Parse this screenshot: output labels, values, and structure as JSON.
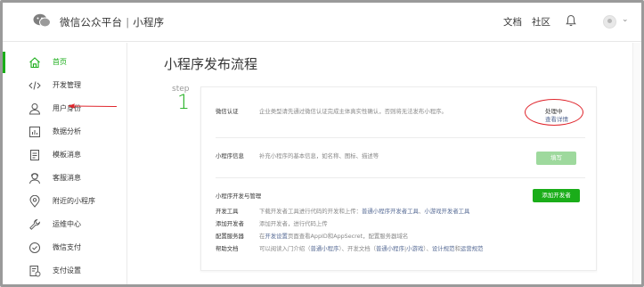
{
  "header": {
    "title": "微信公众平台",
    "separator": "|",
    "subtitle": "小程序",
    "nav": [
      "文档",
      "社区"
    ],
    "caret": "⌄"
  },
  "sidebar": {
    "items": [
      {
        "label": "首页",
        "icon": "home-icon",
        "active": true
      },
      {
        "label": "开发管理",
        "icon": "code-icon"
      },
      {
        "label": "用户身份",
        "icon": "user-icon"
      },
      {
        "label": "数据分析",
        "icon": "chart-icon"
      },
      {
        "label": "模板消息",
        "icon": "document-icon"
      },
      {
        "label": "客服消息",
        "icon": "customer-service-icon"
      },
      {
        "label": "附近的小程序",
        "icon": "location-icon"
      },
      {
        "label": "运维中心",
        "icon": "wrench-icon"
      },
      {
        "label": "微信支付",
        "icon": "payment-icon"
      },
      {
        "label": "支付设置",
        "icon": "payment-settings-icon"
      }
    ]
  },
  "main": {
    "title": "小程序发布流程",
    "step_label": "step",
    "step_number": "1",
    "rows": {
      "verify": {
        "label": "微信认证",
        "desc": "企业类型请先通过微信认证完成主体真实性确认，否则将无法发布小程序。",
        "status": "处理中",
        "status_link": "查看详情"
      },
      "info": {
        "label": "小程序信息",
        "desc": "补充小程序的基本信息，如名称、图标、描述等",
        "button": "填写"
      },
      "dev": {
        "label": "小程序开发与管理",
        "button": "添加开发者",
        "lines": [
          {
            "label": "开发工具",
            "desc_pre": "下载开发者工具进行代码的开发和上传：",
            "link1": "普通小程序开发者工具",
            "mid": "、",
            "link2": "小游戏开发者工具"
          },
          {
            "label": "添加开发者",
            "desc_pre": "添加开发者，进行代码上传"
          },
          {
            "label": "配置服务器",
            "desc_pre": "在",
            "link1": "开发设置",
            "mid": "页面查看AppID和AppSecret，配置服务器域名"
          },
          {
            "label": "帮助文档",
            "desc_pre": "可以阅读入门介绍（",
            "link1": "普通小程序",
            "mid": "）、开发文档（",
            "link2": "普通小程序",
            "mid2": "|",
            "link3": "小游戏",
            "mid3": "）、",
            "link4": "设计规范",
            "mid4": "和",
            "link5": "运营规范"
          }
        ]
      }
    }
  },
  "colors": {
    "accent": "#1aad19",
    "link": "#576b95",
    "annotation": "#e0262d",
    "button_disabled": "#9ed99d"
  }
}
